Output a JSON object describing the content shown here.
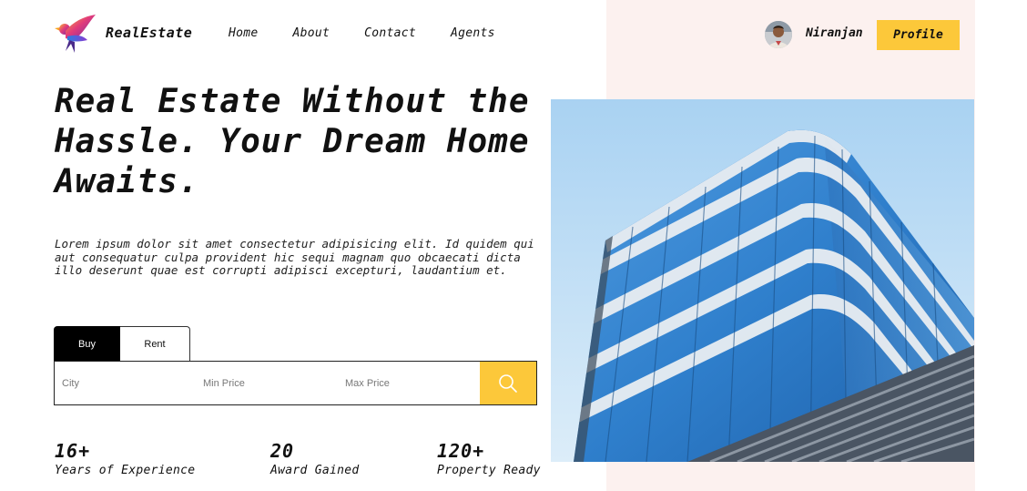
{
  "nav": {
    "brand": "RealEstate",
    "links": [
      "Home",
      "About",
      "Contact",
      "Agents"
    ],
    "user_name": "Niranjan",
    "profile_label": "Profile",
    "logo_icon": "bird-logo-icon",
    "avatar_icon": "user-avatar"
  },
  "hero": {
    "headline": "Real Estate Without the Hassle. Your Dream Home Awaits.",
    "description": "Lorem ipsum dolor sit amet consectetur adipisicing elit. Id quidem qui aut consequatur culpa provident hic sequi magnam quo obcaecati dicta illo deserunt quae est corrupti adipisci excepturi, laudantium et.",
    "image_icon": "glass-building-image"
  },
  "search": {
    "tabs": [
      "Buy",
      "Rent"
    ],
    "active_tab": "Buy",
    "city_placeholder": "City",
    "min_price_placeholder": "Min Price",
    "max_price_placeholder": "Max Price",
    "button_icon": "search-icon"
  },
  "stats": [
    {
      "value": "16+",
      "label": "Years of Experience"
    },
    {
      "value": "20",
      "label": "Award Gained"
    },
    {
      "value": "120+",
      "label": "Property Ready"
    }
  ],
  "colors": {
    "accent": "#fcc83a",
    "panel": "#fcf1ef",
    "dark": "#000000"
  }
}
